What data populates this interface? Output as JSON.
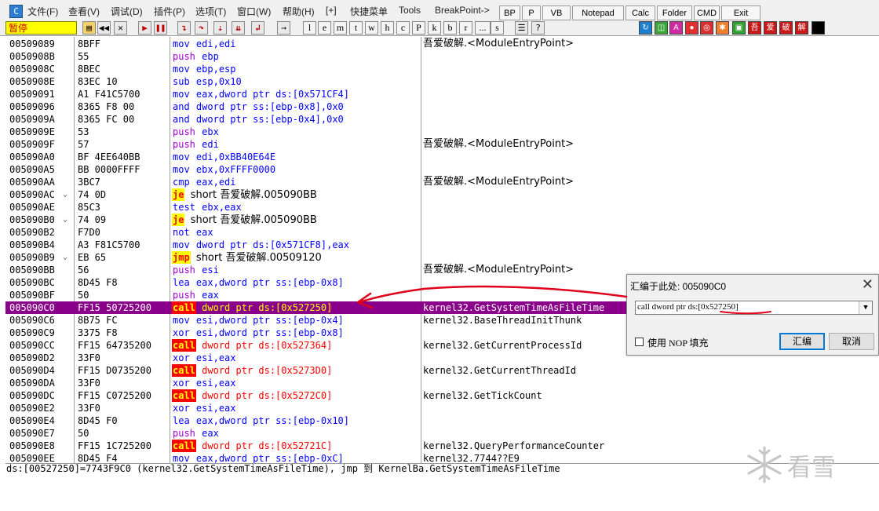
{
  "menu": {
    "items": [
      "文件(F)",
      "查看(V)",
      "调试(D)",
      "插件(P)",
      "选项(T)",
      "窗口(W)",
      "帮助(H)",
      "[+]",
      "快捷菜单",
      "Tools",
      "BreakPoint->"
    ],
    "plugin_buttons": [
      "BP",
      "P",
      "VB",
      "Notepad",
      "Calc",
      "Folder",
      "CMD",
      "Exit"
    ]
  },
  "toolbar": {
    "status": "暂停",
    "letters": [
      "l",
      "e",
      "m",
      "t",
      "w",
      "h",
      "c",
      "P",
      "k",
      "b",
      "r",
      "...",
      "s"
    ],
    "right_buttons": [
      "吾",
      "爱",
      "破",
      "解"
    ]
  },
  "disasm": {
    "rows": [
      {
        "addr": "00509089",
        "arrow": "",
        "hex": "8BFF",
        "mn": "mov",
        "ops": "edi,edi",
        "comment": "吾爱破解.<ModuleEntryPoint>"
      },
      {
        "addr": "0050908B",
        "arrow": "",
        "hex": "55",
        "mn": "push",
        "ops": "ebp",
        "comment": ""
      },
      {
        "addr": "0050908C",
        "arrow": "",
        "hex": "8BEC",
        "mn": "mov",
        "ops": "ebp,esp",
        "comment": ""
      },
      {
        "addr": "0050908E",
        "arrow": "",
        "hex": "83EC 10",
        "mn": "sub",
        "ops": "esp,0x10",
        "comment": ""
      },
      {
        "addr": "00509091",
        "arrow": "",
        "hex": "A1 F41C5700",
        "mn": "mov",
        "ops": "eax,dword ptr ds:[0x571CF4]",
        "comment": ""
      },
      {
        "addr": "00509096",
        "arrow": "",
        "hex": "8365 F8 00",
        "mn": "and",
        "ops": "dword ptr ss:[ebp-0x8],0x0",
        "comment": ""
      },
      {
        "addr": "0050909A",
        "arrow": "",
        "hex": "8365 FC 00",
        "mn": "and",
        "ops": "dword ptr ss:[ebp-0x4],0x0",
        "comment": ""
      },
      {
        "addr": "0050909E",
        "arrow": "",
        "hex": "53",
        "mn": "push",
        "ops": "ebx",
        "comment": ""
      },
      {
        "addr": "0050909F",
        "arrow": "",
        "hex": "57",
        "mn": "push",
        "ops": "edi",
        "comment": "吾爱破解.<ModuleEntryPoint>"
      },
      {
        "addr": "005090A0",
        "arrow": "",
        "hex": "BF 4EE640BB",
        "mn": "mov",
        "ops": "edi,0xBB40E64E",
        "comment": ""
      },
      {
        "addr": "005090A5",
        "arrow": "",
        "hex": "BB 0000FFFF",
        "mn": "mov",
        "ops": "ebx,0xFFFF0000",
        "comment": ""
      },
      {
        "addr": "005090AA",
        "arrow": "",
        "hex": "3BC7",
        "mn": "cmp",
        "ops": "eax,edi",
        "comment": "吾爱破解.<ModuleEntryPoint>"
      },
      {
        "addr": "005090AC",
        "arrow": "⌄",
        "hex": "74 0D",
        "mn": "je",
        "ops": "short 吾爱破解.005090BB",
        "comment": ""
      },
      {
        "addr": "005090AE",
        "arrow": "",
        "hex": "85C3",
        "mn": "test",
        "ops": "ebx,eax",
        "comment": ""
      },
      {
        "addr": "005090B0",
        "arrow": "⌄",
        "hex": "74 09",
        "mn": "je",
        "ops": "short 吾爱破解.005090BB",
        "comment": ""
      },
      {
        "addr": "005090B2",
        "arrow": "",
        "hex": "F7D0",
        "mn": "not",
        "ops": "eax",
        "comment": ""
      },
      {
        "addr": "005090B4",
        "arrow": "",
        "hex": "A3 F81C5700",
        "mn": "mov",
        "ops": "dword ptr ds:[0x571CF8],eax",
        "comment": ""
      },
      {
        "addr": "005090B9",
        "arrow": "⌄",
        "hex": "EB 65",
        "mn": "jmp",
        "ops": "short 吾爱破解.00509120",
        "comment": ""
      },
      {
        "addr": "005090BB",
        "arrow": "",
        "hex": "56",
        "mn": "push",
        "ops": "esi",
        "comment": "吾爱破解.<ModuleEntryPoint>"
      },
      {
        "addr": "005090BC",
        "arrow": "",
        "hex": "8D45 F8",
        "mn": "lea",
        "ops": "eax,dword ptr ss:[ebp-0x8]",
        "comment": ""
      },
      {
        "addr": "005090BF",
        "arrow": "",
        "hex": "50",
        "mn": "push",
        "ops": "eax",
        "comment": ""
      },
      {
        "addr": "005090C0",
        "arrow": "",
        "hex": "FF15 50725200",
        "mn": "call",
        "ops": "dword ptr ds:[0x527250]",
        "comment": "kernel32.GetSystemTimeAsFileTime"
      },
      {
        "addr": "005090C6",
        "arrow": "",
        "hex": "8B75 FC",
        "mn": "mov",
        "ops": "esi,dword ptr ss:[ebp-0x4]",
        "comment": "kernel32.BaseThreadInitThunk"
      },
      {
        "addr": "005090C9",
        "arrow": "",
        "hex": "3375 F8",
        "mn": "xor",
        "ops": "esi,dword ptr ss:[ebp-0x8]",
        "comment": ""
      },
      {
        "addr": "005090CC",
        "arrow": "",
        "hex": "FF15 64735200",
        "mn": "call",
        "ops": "dword ptr ds:[0x527364]",
        "comment": "kernel32.GetCurrentProcessId"
      },
      {
        "addr": "005090D2",
        "arrow": "",
        "hex": "33F0",
        "mn": "xor",
        "ops": "esi,eax",
        "comment": ""
      },
      {
        "addr": "005090D4",
        "arrow": "",
        "hex": "FF15 D0735200",
        "mn": "call",
        "ops": "dword ptr ds:[0x5273D0]",
        "comment": "kernel32.GetCurrentThreadId"
      },
      {
        "addr": "005090DA",
        "arrow": "",
        "hex": "33F0",
        "mn": "xor",
        "ops": "esi,eax",
        "comment": ""
      },
      {
        "addr": "005090DC",
        "arrow": "",
        "hex": "FF15 C0725200",
        "mn": "call",
        "ops": "dword ptr ds:[0x5272C0]",
        "comment": "kernel32.GetTickCount"
      },
      {
        "addr": "005090E2",
        "arrow": "",
        "hex": "33F0",
        "mn": "xor",
        "ops": "esi,eax",
        "comment": ""
      },
      {
        "addr": "005090E4",
        "arrow": "",
        "hex": "8D45 F0",
        "mn": "lea",
        "ops": "eax,dword ptr ss:[ebp-0x10]",
        "comment": ""
      },
      {
        "addr": "005090E7",
        "arrow": "",
        "hex": "50",
        "mn": "push",
        "ops": "eax",
        "comment": ""
      },
      {
        "addr": "005090E8",
        "arrow": "",
        "hex": "FF15 1C725200",
        "mn": "call",
        "ops": "dword ptr ds:[0x52721C]",
        "comment": "kernel32.QueryPerformanceCounter"
      },
      {
        "addr": "005090EE",
        "arrow": "",
        "hex": "8D45 F4",
        "mn": "mov",
        "ops": "eax,dword ptr ss:[ebp-0xC]",
        "comment": "kernel32.7744??E9"
      }
    ],
    "selected_index": 21
  },
  "info": {
    "text": "ds:[00527250]=7743F9C0 (kernel32.GetSystemTimeAsFileTime), jmp 到 KernelBa.GetSystemTimeAsFileTime"
  },
  "dialog": {
    "title": "汇编于此处: 005090C0",
    "input_value": "call dword ptr ds:[0x527250]",
    "checkbox_label": "使用 NOP 填充",
    "assemble_label": "汇编",
    "cancel_label": "取消"
  },
  "watermark": {
    "text": "看雪"
  },
  "colors": {
    "selected_row": "#8b008b",
    "mnemonic_blue": "#0000ff",
    "mnemonic_purple": "#a000c8",
    "jump_highlight": "#ffff00",
    "call_highlight": "#ff0000",
    "annotation_red": "#e0001a"
  }
}
